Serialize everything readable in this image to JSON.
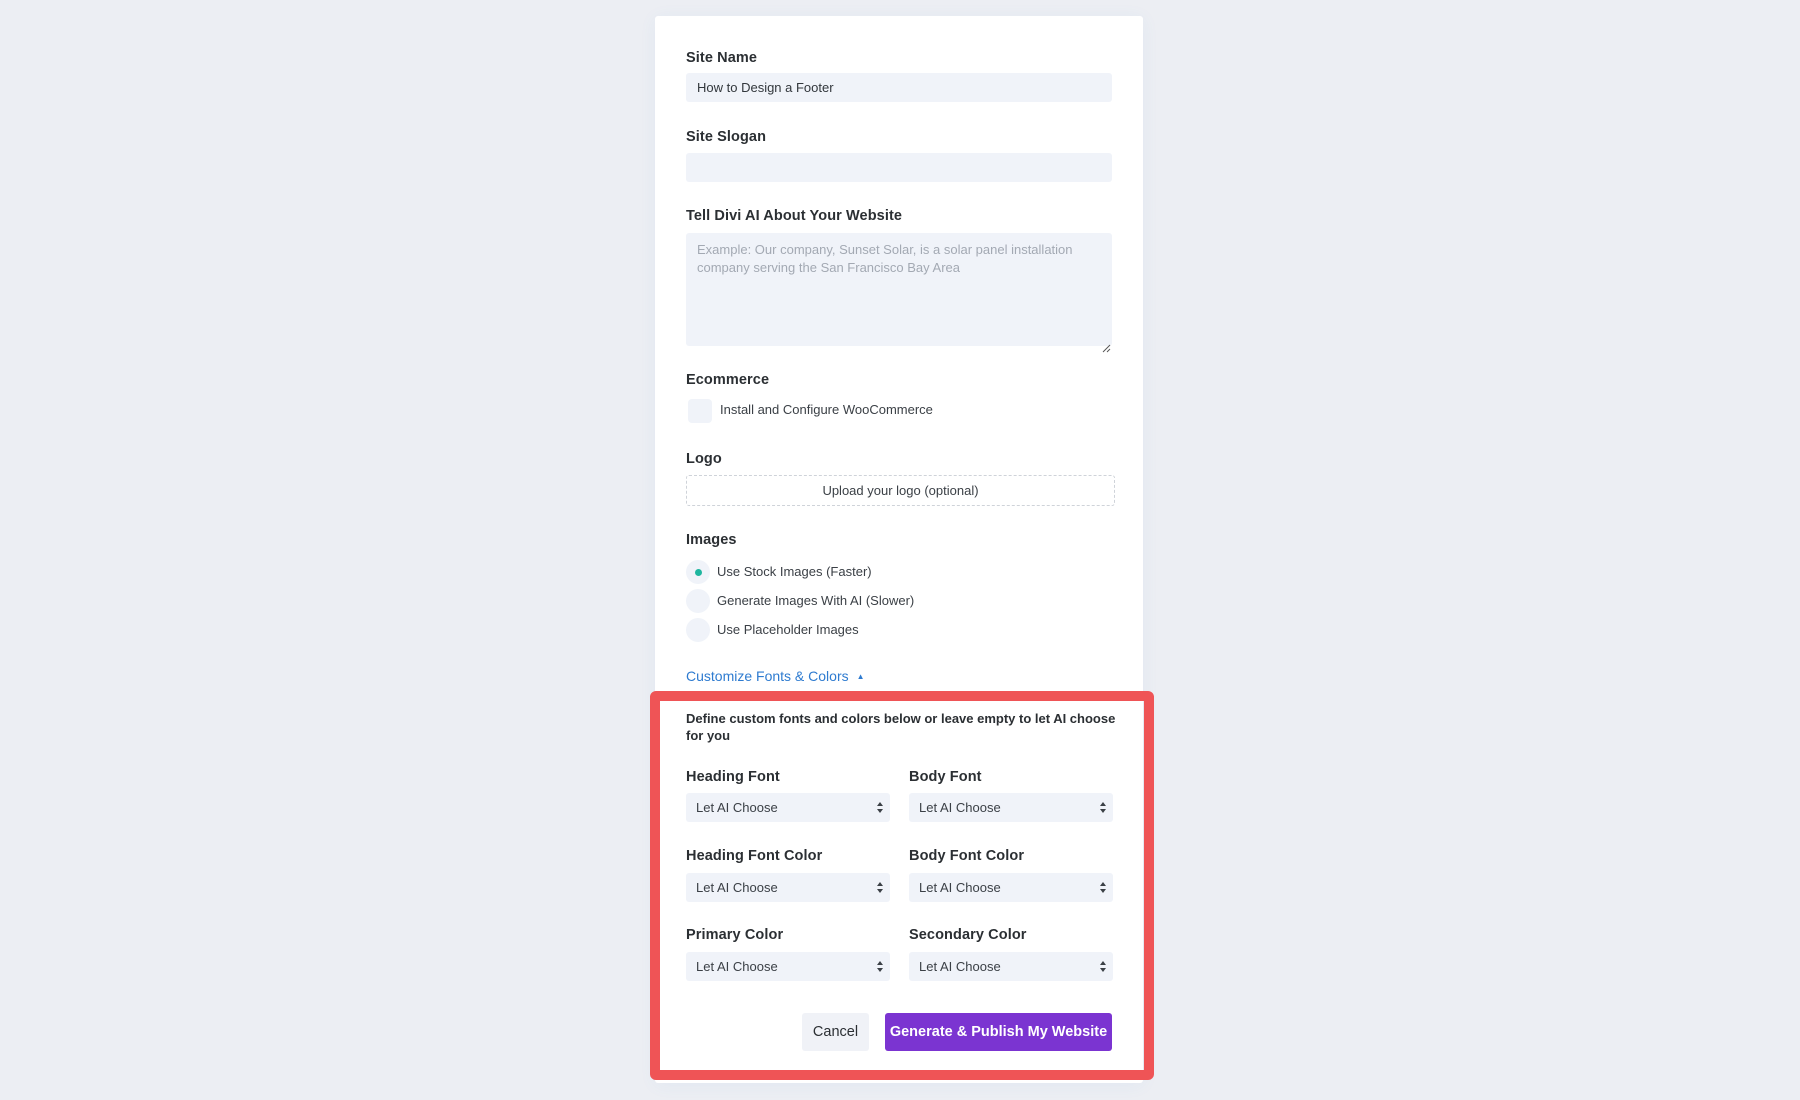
{
  "form": {
    "site_name": {
      "label": "Site Name",
      "value": "How to Design a Footer"
    },
    "site_slogan": {
      "label": "Site Slogan",
      "value": ""
    },
    "about": {
      "label": "Tell Divi AI About Your Website",
      "placeholder": "Example: Our company, Sunset Solar, is a solar panel installation company serving the San Francisco Bay Area",
      "value": ""
    },
    "ecommerce": {
      "label": "Ecommerce",
      "checkbox_label": "Install and Configure WooCommerce",
      "checked": false
    },
    "logo": {
      "label": "Logo",
      "upload_label": "Upload your logo (optional)"
    },
    "images": {
      "label": "Images",
      "options": [
        {
          "label": "Use Stock Images (Faster)",
          "selected": true
        },
        {
          "label": "Generate Images With AI (Slower)",
          "selected": false
        },
        {
          "label": "Use Placeholder Images",
          "selected": false
        }
      ]
    },
    "customize": {
      "link_label": "Customize Fonts & Colors",
      "caret_icon": "triangle-up",
      "expanded": true,
      "description": "Define custom fonts and colors below or leave empty to let AI choose for you",
      "fields": [
        {
          "label": "Heading Font",
          "value": "Let AI Choose"
        },
        {
          "label": "Body Font",
          "value": "Let AI Choose"
        },
        {
          "label": "Heading Font Color",
          "value": "Let AI Choose"
        },
        {
          "label": "Body Font Color",
          "value": "Let AI Choose"
        },
        {
          "label": "Primary Color",
          "value": "Let AI Choose"
        },
        {
          "label": "Secondary Color",
          "value": "Let AI Choose"
        }
      ]
    },
    "buttons": {
      "cancel": "Cancel",
      "submit": "Generate & Publish My Website"
    }
  },
  "colors": {
    "background": "#eceef3",
    "card": "#ffffff",
    "input_bg": "#f0f3f9",
    "accent_link": "#2e7bd0",
    "radio_selected": "#1fb69f",
    "primary_button": "#7b34d1",
    "highlight_annotation": "#ef5456"
  }
}
